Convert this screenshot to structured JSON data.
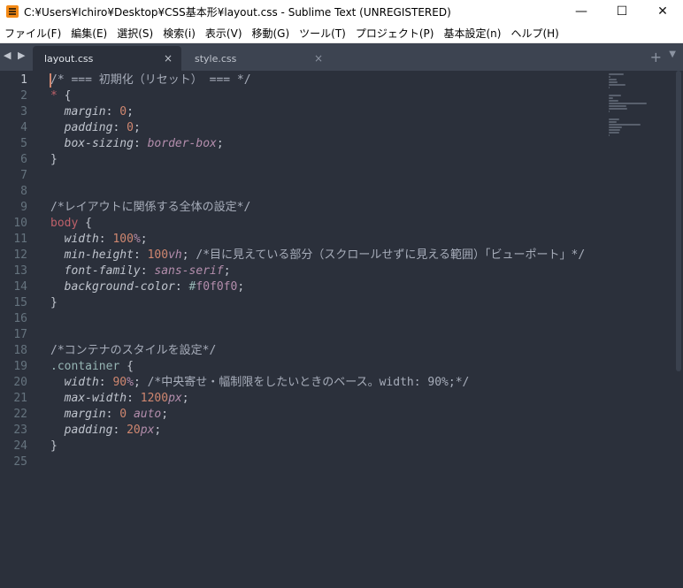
{
  "window": {
    "title": "C:¥Users¥Ichiro¥Desktop¥CSS基本形¥layout.css - Sublime Text (UNREGISTERED)",
    "minimize": "—",
    "maximize": "☐",
    "close": "✕"
  },
  "menu": [
    "ファイル(F)",
    "編集(E)",
    "選択(S)",
    "検索(i)",
    "表示(V)",
    "移動(G)",
    "ツール(T)",
    "プロジェクト(P)",
    "基本設定(n)",
    "ヘルプ(H)"
  ],
  "tabs": {
    "nav": "◀ ▶",
    "items": [
      {
        "label": "layout.css",
        "close": "×"
      },
      {
        "label": "style.css",
        "close": "×"
      }
    ],
    "new_tab": "+",
    "dropdown": "▼"
  },
  "editor": {
    "current_line": 1,
    "line_numbers": [
      "1",
      "2",
      "3",
      "4",
      "5",
      "6",
      "7",
      "8",
      "9",
      "10",
      "11",
      "12",
      "13",
      "14",
      "15",
      "16",
      "17",
      "18",
      "19",
      "20",
      "21",
      "22",
      "23",
      "24",
      "25"
    ],
    "lines": [
      "/* === 初期化（リセット） === */",
      "* {",
      "  margin: 0;",
      "  padding: 0;",
      "  box-sizing: border-box;",
      "}",
      "",
      "",
      "/*レイアウトに関係する全体の設定*/",
      "body {",
      "  width: 100%;",
      "  min-height: 100vh; /*目に見えている部分（スクロールせずに見える範囲）「ビューポート」*/",
      "  font-family: sans-serif;",
      "  background-color: #f0f0f0;",
      "}",
      "",
      "",
      "/*コンテナのスタイルを設定*/",
      ".container {",
      "  width: 90%; /*中央寄せ・幅制限をしたいときのベース。width: 90%;*/",
      "  max-width: 1200px;",
      "  margin: 0 auto;",
      "  padding: 20px;",
      "}",
      ""
    ]
  },
  "colors": {
    "background": "#2b303b",
    "comment": "#a7adba",
    "selector": "#bf616a",
    "number": "#d08770",
    "value": "#b48ead",
    "accent": "#96b5b4"
  }
}
